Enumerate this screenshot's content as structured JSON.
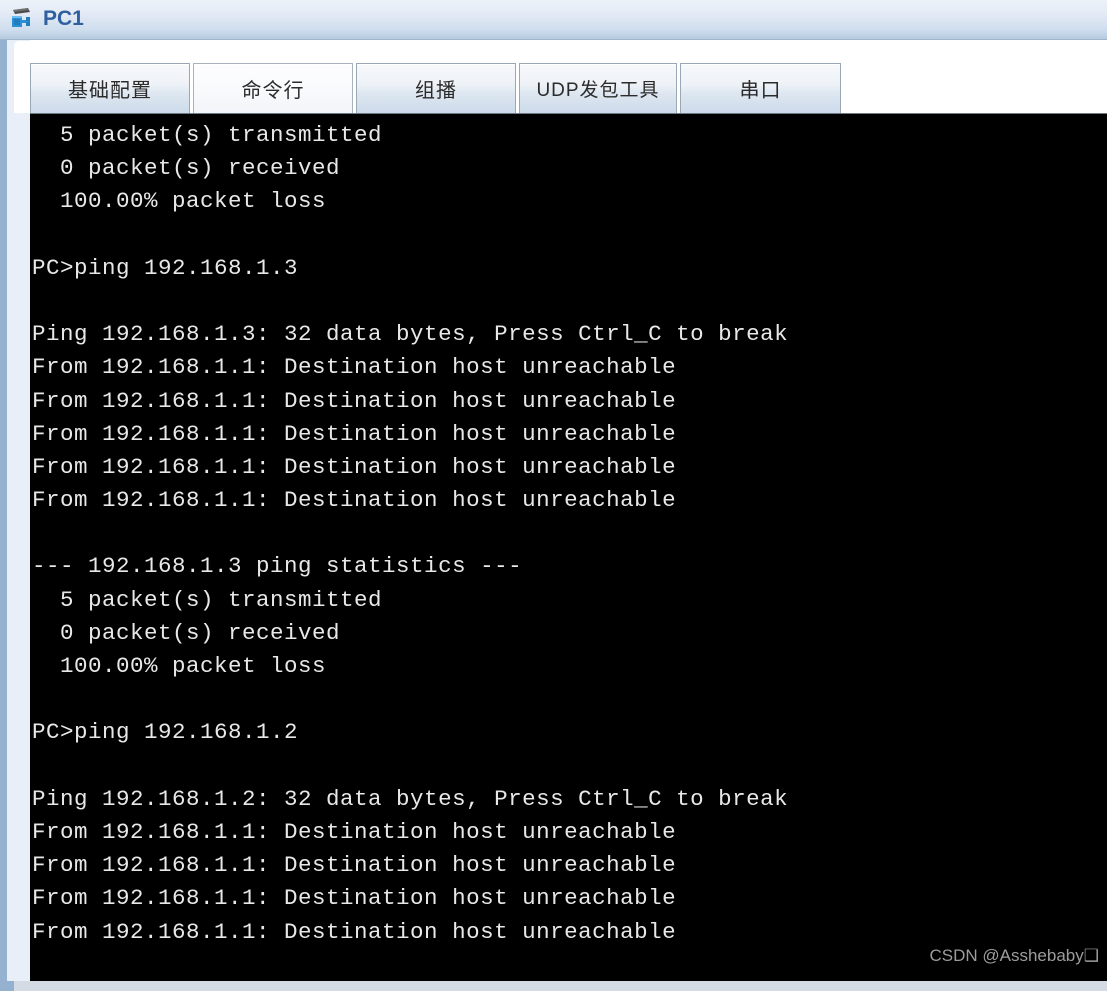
{
  "window": {
    "title": "PC1",
    "icon": "pc-device-icon",
    "title_color": "#2f5f9e"
  },
  "tabs": [
    {
      "label": "基础配置",
      "active": false,
      "name": "tab-basic-config"
    },
    {
      "label": "命令行",
      "active": true,
      "name": "tab-command-line"
    },
    {
      "label": "组播",
      "active": false,
      "name": "tab-multicast"
    },
    {
      "label": "UDP发包工具",
      "active": false,
      "name": "tab-udp-tool"
    },
    {
      "label": "串口",
      "active": false,
      "name": "tab-serial-port"
    }
  ],
  "terminal": {
    "background": "#000000",
    "foreground": "#e8e8e8",
    "lines": [
      "  5 packet(s) transmitted",
      "  0 packet(s) received",
      "  100.00% packet loss",
      "",
      "PC>ping 192.168.1.3",
      "",
      "Ping 192.168.1.3: 32 data bytes, Press Ctrl_C to break",
      "From 192.168.1.1: Destination host unreachable",
      "From 192.168.1.1: Destination host unreachable",
      "From 192.168.1.1: Destination host unreachable",
      "From 192.168.1.1: Destination host unreachable",
      "From 192.168.1.1: Destination host unreachable",
      "",
      "--- 192.168.1.3 ping statistics ---",
      "  5 packet(s) transmitted",
      "  0 packet(s) received",
      "  100.00% packet loss",
      "",
      "PC>ping 192.168.1.2",
      "",
      "Ping 192.168.1.2: 32 data bytes, Press Ctrl_C to break",
      "From 192.168.1.1: Destination host unreachable",
      "From 192.168.1.1: Destination host unreachable",
      "From 192.168.1.1: Destination host unreachable",
      "From 192.168.1.1: Destination host unreachable"
    ]
  },
  "watermark": {
    "text": "CSDN @Asshebaby❑"
  }
}
